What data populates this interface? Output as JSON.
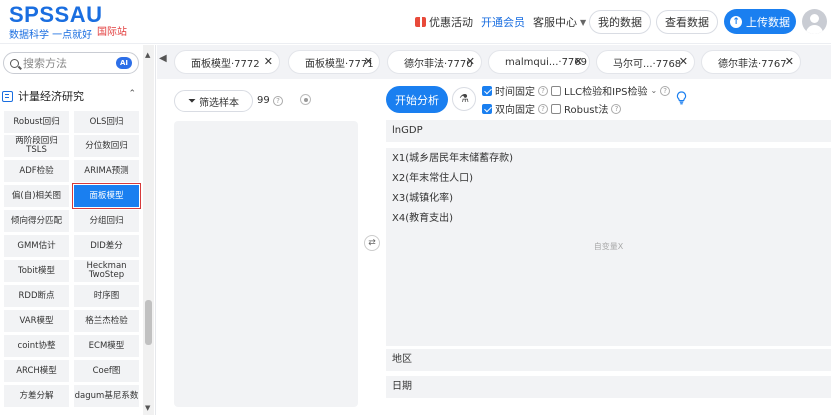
{
  "header": {
    "logo_main": "SPSSAU",
    "logo_sub": "数据科学 一点就好",
    "intl_link": "国际站",
    "promo": "优惠活动",
    "vip": "开通会员",
    "service": "客服中心",
    "my_data": "我的数据",
    "view_data": "查看数据",
    "upload": "上传数据"
  },
  "sidebar": {
    "search_placeholder": "搜索方法",
    "ai_badge": "AI",
    "section_title": "计量经济研究",
    "methods": [
      [
        "Robust回归",
        "OLS回归"
      ],
      [
        "两阶段回归 TSLS",
        "分位数回归"
      ],
      [
        "ADF检验",
        "ARIMA预测"
      ],
      [
        "偏(自)相关图",
        "面板模型"
      ],
      [
        "倾向得分匹配",
        "分组回归"
      ],
      [
        "GMM估计",
        "DID差分"
      ],
      [
        "Tobit模型",
        "Heckman TwoStep"
      ],
      [
        "RDD断点",
        "时序图"
      ],
      [
        "VAR模型",
        "格兰杰检验"
      ],
      [
        "coint协整",
        "ECM模型"
      ],
      [
        "ARCH模型",
        "Coef图"
      ],
      [
        "方差分解",
        "dagum基尼系数"
      ]
    ],
    "active_method": "面板模型"
  },
  "tabs": [
    {
      "label": "面板模型·7772"
    },
    {
      "label": "面板模型·7771"
    },
    {
      "label": "德尔菲法·7770"
    },
    {
      "label": "malmqui...·7769"
    },
    {
      "label": "马尔可...·7768"
    },
    {
      "label": "德尔菲法·7767"
    }
  ],
  "left_panel": {
    "filter_label": "筛选样本",
    "count": "99"
  },
  "toolbar": {
    "run_label": "开始分析",
    "opt_time_fixed": "时间固定",
    "opt_llc": "LLC检验和IPS检验",
    "opt_twoway": "双向固定",
    "opt_robust": "Robust法",
    "time_fixed_checked": true,
    "llc_checked": false,
    "twoway_checked": true,
    "robust_checked": false
  },
  "fields": {
    "dependent": "lnGDP",
    "independents": [
      "X1(城乡居民年末储蓄存款)",
      "X2(年末常住人口)",
      "X3(城镇化率)",
      "X4(教育支出)"
    ],
    "independent_hint": "自变量X",
    "region": "地区",
    "date": "日期"
  },
  "colors": {
    "brand": "#1a6ee0",
    "accent": "#1a7ff0",
    "intl": "#e23b3b",
    "highlight_border": "#d63a3a"
  }
}
